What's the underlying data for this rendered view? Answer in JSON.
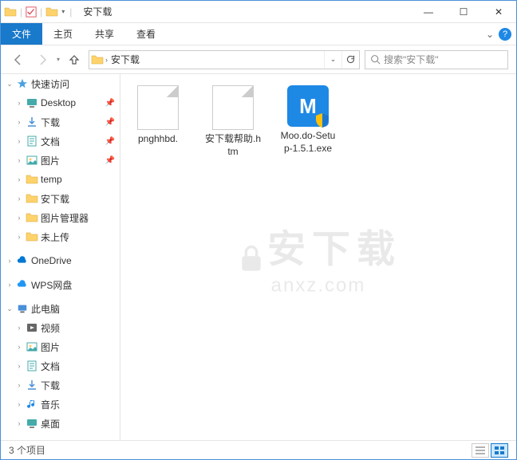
{
  "window": {
    "title": "安下载",
    "min": "—",
    "max": "☐",
    "close": "✕"
  },
  "ribbon": {
    "file": "文件",
    "home": "主页",
    "share": "共享",
    "view": "查看"
  },
  "nav": {
    "path_seg": "安下载",
    "search_placeholder": "搜索\"安下载\""
  },
  "sidebar": {
    "quick": "快速访问",
    "items": [
      {
        "label": "Desktop",
        "icon": "desktop",
        "pin": true
      },
      {
        "label": "下载",
        "icon": "download",
        "pin": true
      },
      {
        "label": "文档",
        "icon": "doc",
        "pin": true
      },
      {
        "label": "图片",
        "icon": "pic",
        "pin": true
      },
      {
        "label": "temp",
        "icon": "folder",
        "pin": false
      },
      {
        "label": "安下载",
        "icon": "folder",
        "pin": false
      },
      {
        "label": "图片管理器",
        "icon": "folder",
        "pin": false
      },
      {
        "label": "未上传",
        "icon": "folder",
        "pin": false
      }
    ],
    "onedrive": "OneDrive",
    "wps": "WPS网盘",
    "thispc": "此电脑",
    "pc_items": [
      {
        "label": "视频",
        "icon": "video"
      },
      {
        "label": "图片",
        "icon": "pic"
      },
      {
        "label": "文档",
        "icon": "doc"
      },
      {
        "label": "下载",
        "icon": "download"
      },
      {
        "label": "音乐",
        "icon": "music"
      },
      {
        "label": "桌面",
        "icon": "desktop"
      }
    ]
  },
  "files": [
    {
      "name": "pnghhbd.",
      "type": "blank"
    },
    {
      "name": "安下载帮助.htm",
      "type": "blank"
    },
    {
      "name": "Moo.do-Setup-1.5.1.exe",
      "type": "exe"
    }
  ],
  "watermark": {
    "top": "安下载",
    "bot": "anxz.com"
  },
  "status": {
    "text": "3 个项目"
  }
}
